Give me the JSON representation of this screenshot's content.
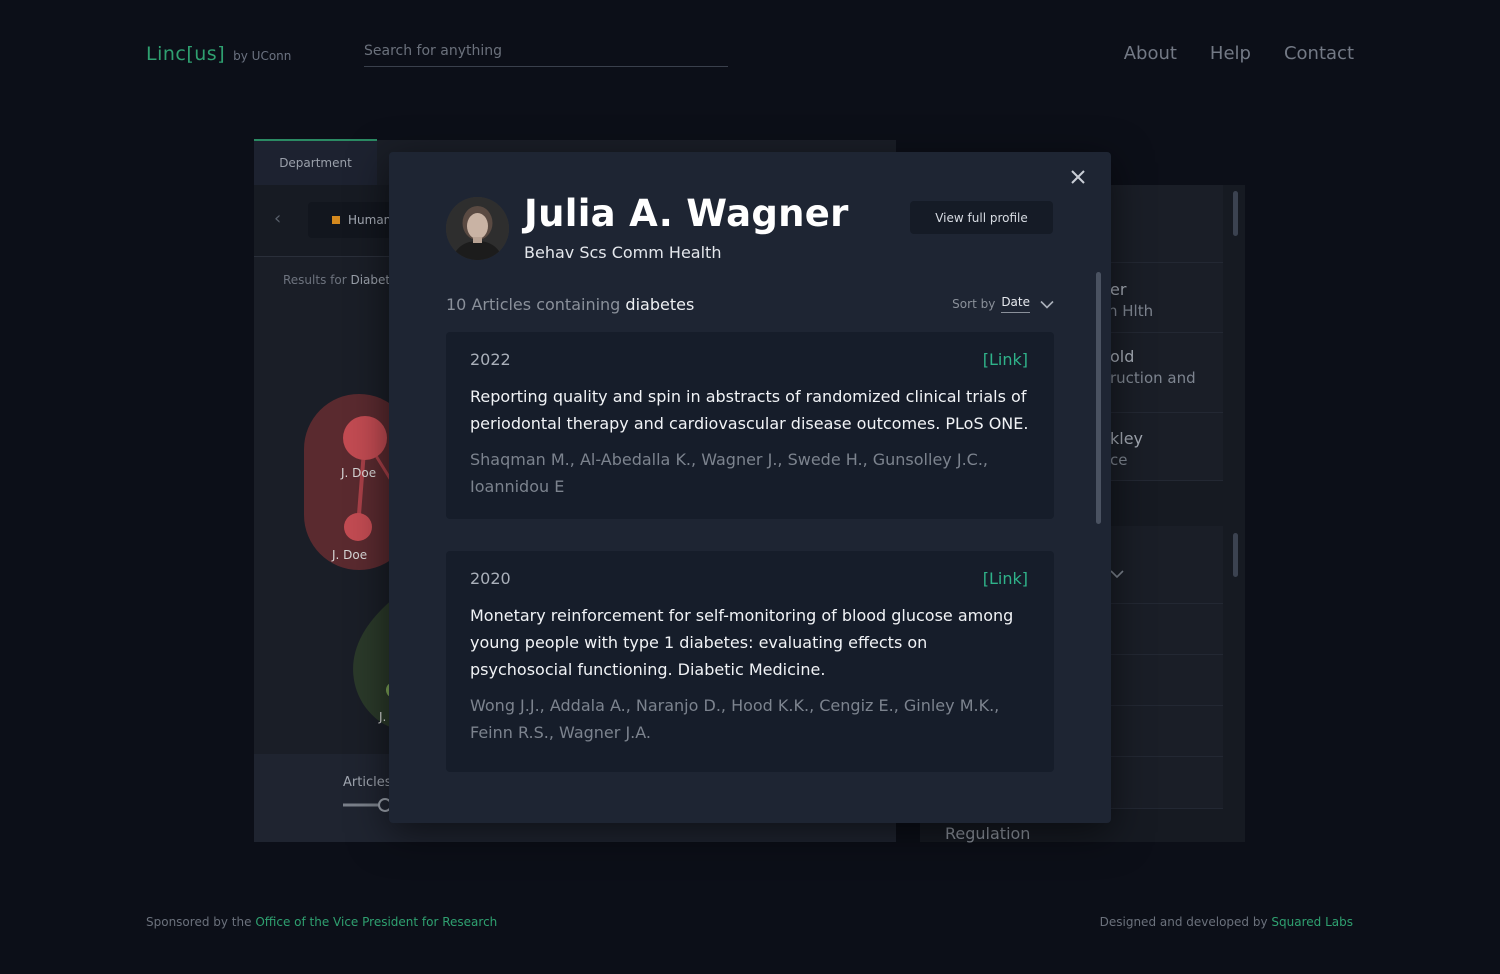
{
  "header": {
    "brand_name": "Linc[us]",
    "brand_by": "by UConn",
    "search_placeholder": "Search for anything",
    "nav": [
      "About",
      "Help",
      "Contact"
    ]
  },
  "background": {
    "tab_label": "Department",
    "chip_label": "Human",
    "results_prefix": "Results for",
    "results_term": "Diabet",
    "graph_labels": [
      "J. Doe",
      "J. Doe",
      "J."
    ],
    "articles_label": "Articles",
    "right_rows": [
      {
        "line1": "er",
        "line2": "n Hlth"
      },
      {
        "line1": "old",
        "line2": "ruction and"
      },
      {
        "line1": "kley",
        "line2": "ce"
      }
    ],
    "right_bottom_label": "Regulation"
  },
  "modal": {
    "name": "Julia A. Wagner",
    "department": "Behav Scs Comm Health",
    "view_profile_label": "View full profile",
    "article_count_text": "10 Articles containing",
    "keyword": "diabetes",
    "sort_label": "Sort by",
    "sort_value": "Date",
    "articles": [
      {
        "year": "2022",
        "link_label": "[Link]",
        "title": "Reporting quality and spin in abstracts of randomized clinical trials of periodontal therapy and cardiovascular disease outcomes. PLoS ONE.",
        "authors": "Shaqman M., Al-Abedalla K., Wagner J., Swede H., Gunsolley J.C., Ioannidou E"
      },
      {
        "year": "2020",
        "link_label": "[Link]",
        "title": "Monetary reinforcement for self-monitoring of blood glucose among young people with type 1 diabetes: evaluating effects on psychosocial functioning. Diabetic Medicine.",
        "authors": "Wong J.J., Addala A., Naranjo D., Hood K.K., Cengiz E., Ginley M.K., Feinn R.S., Wagner J.A."
      }
    ]
  },
  "footer": {
    "left_prefix": "Sponsored by the",
    "left_link": "Office of the Vice President for Research",
    "right_prefix": "Designed and developed by",
    "right_link": "Squared Labs"
  },
  "colors": {
    "background": "#0c0f18",
    "accent": "#2fa070",
    "link": "#2fb38a",
    "modal": "#1e2533",
    "card": "#161d2a"
  }
}
